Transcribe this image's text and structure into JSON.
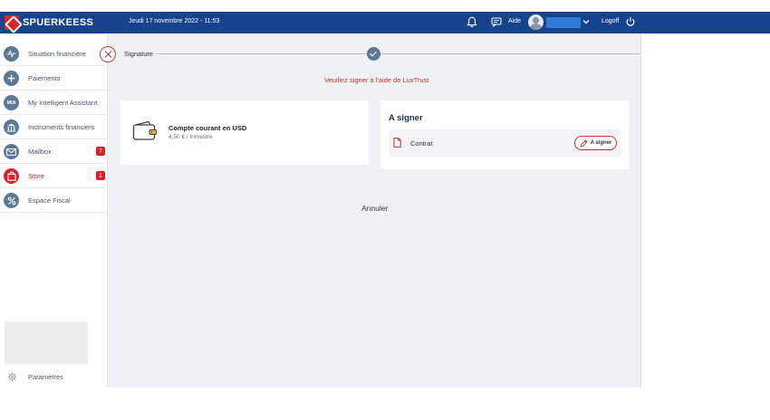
{
  "header": {
    "brand": "SPUERKEESS",
    "date": "Jeudi 17 novembre 2022 - 11:53",
    "help_label": "Aide",
    "logoff_label": "Logoff"
  },
  "sidebar": {
    "items": [
      {
        "label": "Situation financière",
        "icon": "activity-icon"
      },
      {
        "label": "Paiements",
        "icon": "plus-icon"
      },
      {
        "label": "My Intelligent Assistant",
        "icon": "mia-icon",
        "icon_text": "MIA"
      },
      {
        "label": "Instruments financiers",
        "icon": "bank-icon"
      },
      {
        "label": "Mailbox",
        "icon": "mail-icon",
        "badge": "7"
      },
      {
        "label": "Store",
        "icon": "bag-icon",
        "badge": "1",
        "active": true
      },
      {
        "label": "Espace Fiscal",
        "icon": "percent-icon"
      }
    ],
    "settings_label": "Paramètres"
  },
  "stepper": {
    "current_step": "Signature"
  },
  "notice": "Veuillez signer à l'aide de LuxTrust",
  "account": {
    "title": "Compte courant en USD",
    "subtitle": "4,50 € / trimestre"
  },
  "to_sign": {
    "title": "A signer",
    "document_label": "Contrat",
    "sign_button": "A signer"
  },
  "cancel_label": "Annuler",
  "colors": {
    "header_bg": "#17438d",
    "accent_red": "#d81f2a",
    "nav_icon": "#5d7896",
    "main_bg": "#eff2f5"
  }
}
